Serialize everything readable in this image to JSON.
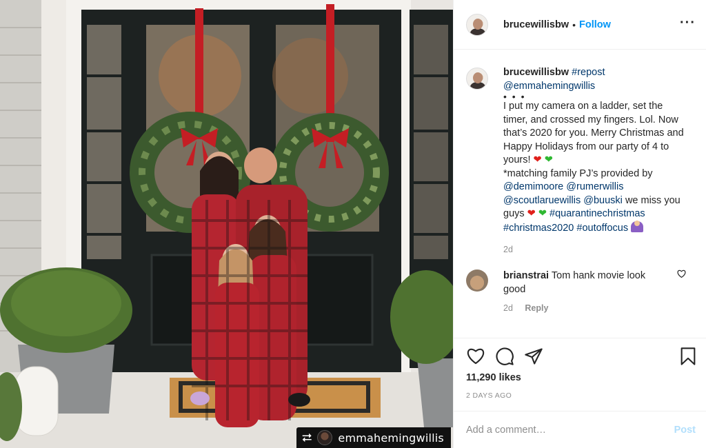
{
  "colors": {
    "accent": "#0095f6",
    "tag_link": "#00376b",
    "muted": "#8e8e8e",
    "post_disabled": "#b2dffc"
  },
  "photo": {
    "repost_badge": {
      "icon": "repost-icon",
      "username": "emmahemingwillis"
    }
  },
  "header": {
    "username": "brucewillisbw",
    "separator": "•",
    "follow_label": "Follow",
    "more_icon": "more-horizontal-icon"
  },
  "caption": {
    "username": "brucewillisbw",
    "hashtag_repost": "#repost",
    "mention_emma": "@emmahemingwillis",
    "dots": "• • •",
    "text_1": "I put my camera on a ladder, set the timer, and crossed my fingers. Lol. Now that’s 2020 for you. Merry Christmas and Happy Holidays from our party of 4 to yours!",
    "heart_red": "❤",
    "heart_green": "❤",
    "text_2": "*matching family PJ’s provided by",
    "mention_demi": "@demimoore",
    "mention_rumer": "@rumerwillis",
    "mention_scout": "@scoutlaruewillis",
    "mention_buuski": "@buuski",
    "text_3": "we miss you guys",
    "hashtag_quarantine": "#quarantinechristmas",
    "hashtag_christmas": "#christmas2020",
    "hashtag_outoffocus": "#outoffocus",
    "time": "2d"
  },
  "comment": {
    "username": "brianstrai",
    "text": "Tom hank movie look good",
    "time": "2d",
    "reply_label": "Reply",
    "like_icon": "heart-outline-icon"
  },
  "actions": {
    "like_icon": "heart-outline-icon",
    "comment_icon": "comment-icon",
    "share_icon": "send-icon",
    "save_icon": "bookmark-icon"
  },
  "likes": "11,290 likes",
  "date": "2 DAYS AGO",
  "comment_box": {
    "placeholder": "Add a comment…",
    "post_label": "Post"
  }
}
